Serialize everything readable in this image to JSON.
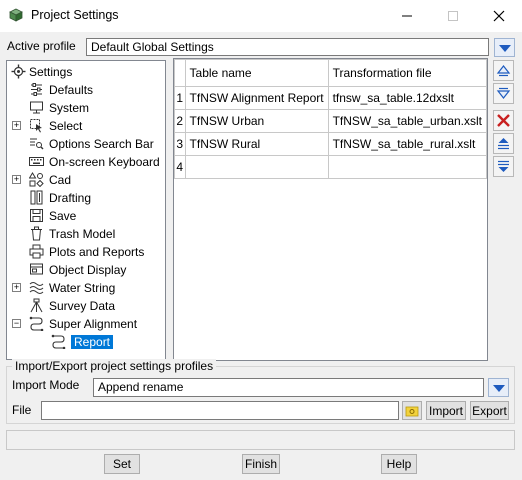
{
  "window": {
    "title": "Project Settings",
    "icon": "cube-app-icon",
    "controls": [
      "minimize-icon",
      "maximize-icon",
      "close-icon"
    ]
  },
  "active_profile": {
    "label": "Active profile",
    "value": "Default Global Settings"
  },
  "tree": {
    "items": [
      {
        "label": "Settings",
        "icon": "gear-icon",
        "expander": ""
      },
      {
        "label": "Defaults",
        "icon": "defaults-icon",
        "expander": ""
      },
      {
        "label": "System",
        "icon": "monitor-icon",
        "expander": ""
      },
      {
        "label": "Select",
        "icon": "select-cursor-icon",
        "expander": "+"
      },
      {
        "label": "Options Search Bar",
        "icon": "search-bar-icon",
        "expander": ""
      },
      {
        "label": "On-screen Keyboard",
        "icon": "keyboard-icon",
        "expander": ""
      },
      {
        "label": "Cad",
        "icon": "shapes-icon",
        "expander": "+"
      },
      {
        "label": "Drafting",
        "icon": "drafting-icon",
        "expander": ""
      },
      {
        "label": "Save",
        "icon": "save-icon",
        "expander": ""
      },
      {
        "label": "Trash Model",
        "icon": "trash-icon",
        "expander": ""
      },
      {
        "label": "Plots and Reports",
        "icon": "printer-icon",
        "expander": ""
      },
      {
        "label": "Object Display",
        "icon": "object-display-icon",
        "expander": ""
      },
      {
        "label": "Water String",
        "icon": "water-icon",
        "expander": "+"
      },
      {
        "label": "Survey Data",
        "icon": "tripod-icon",
        "expander": ""
      },
      {
        "label": "Super Alignment",
        "icon": "alignment-icon",
        "expander": "−"
      },
      {
        "label": "Report",
        "icon": "alignment-icon",
        "expander": ""
      }
    ],
    "selected": "Report"
  },
  "table": {
    "columns": [
      "Table name",
      "Transformation file"
    ],
    "rows": [
      {
        "num": "1",
        "name": "TfNSW Alignment Report",
        "file": "tfnsw_sa_table.12dxslt"
      },
      {
        "num": "2",
        "name": "TfNSW Urban",
        "file": "TfNSW_sa_table_urban.xslt"
      },
      {
        "num": "3",
        "name": "TfNSW Rural",
        "file": "TfNSW_sa_table_rural.xslt"
      },
      {
        "num": "4",
        "name": "",
        "file": ""
      }
    ]
  },
  "side_buttons": [
    "move-up-icon",
    "move-down-icon",
    "delete-row-icon",
    "insert-above-icon",
    "insert-below-icon"
  ],
  "import_export": {
    "group_title": "Import/Export project settings profiles",
    "mode_label": "Import Mode",
    "mode_value": "Append rename",
    "file_label": "File",
    "file_value": "",
    "import_label": "Import",
    "export_label": "Export"
  },
  "footer": {
    "set_label": "Set",
    "finish_label": "Finish",
    "help_label": "Help"
  },
  "colors": {
    "accent": "#0078d7",
    "dropdown_arrow": "#1e5bbf",
    "delete_red": "#c82020"
  }
}
